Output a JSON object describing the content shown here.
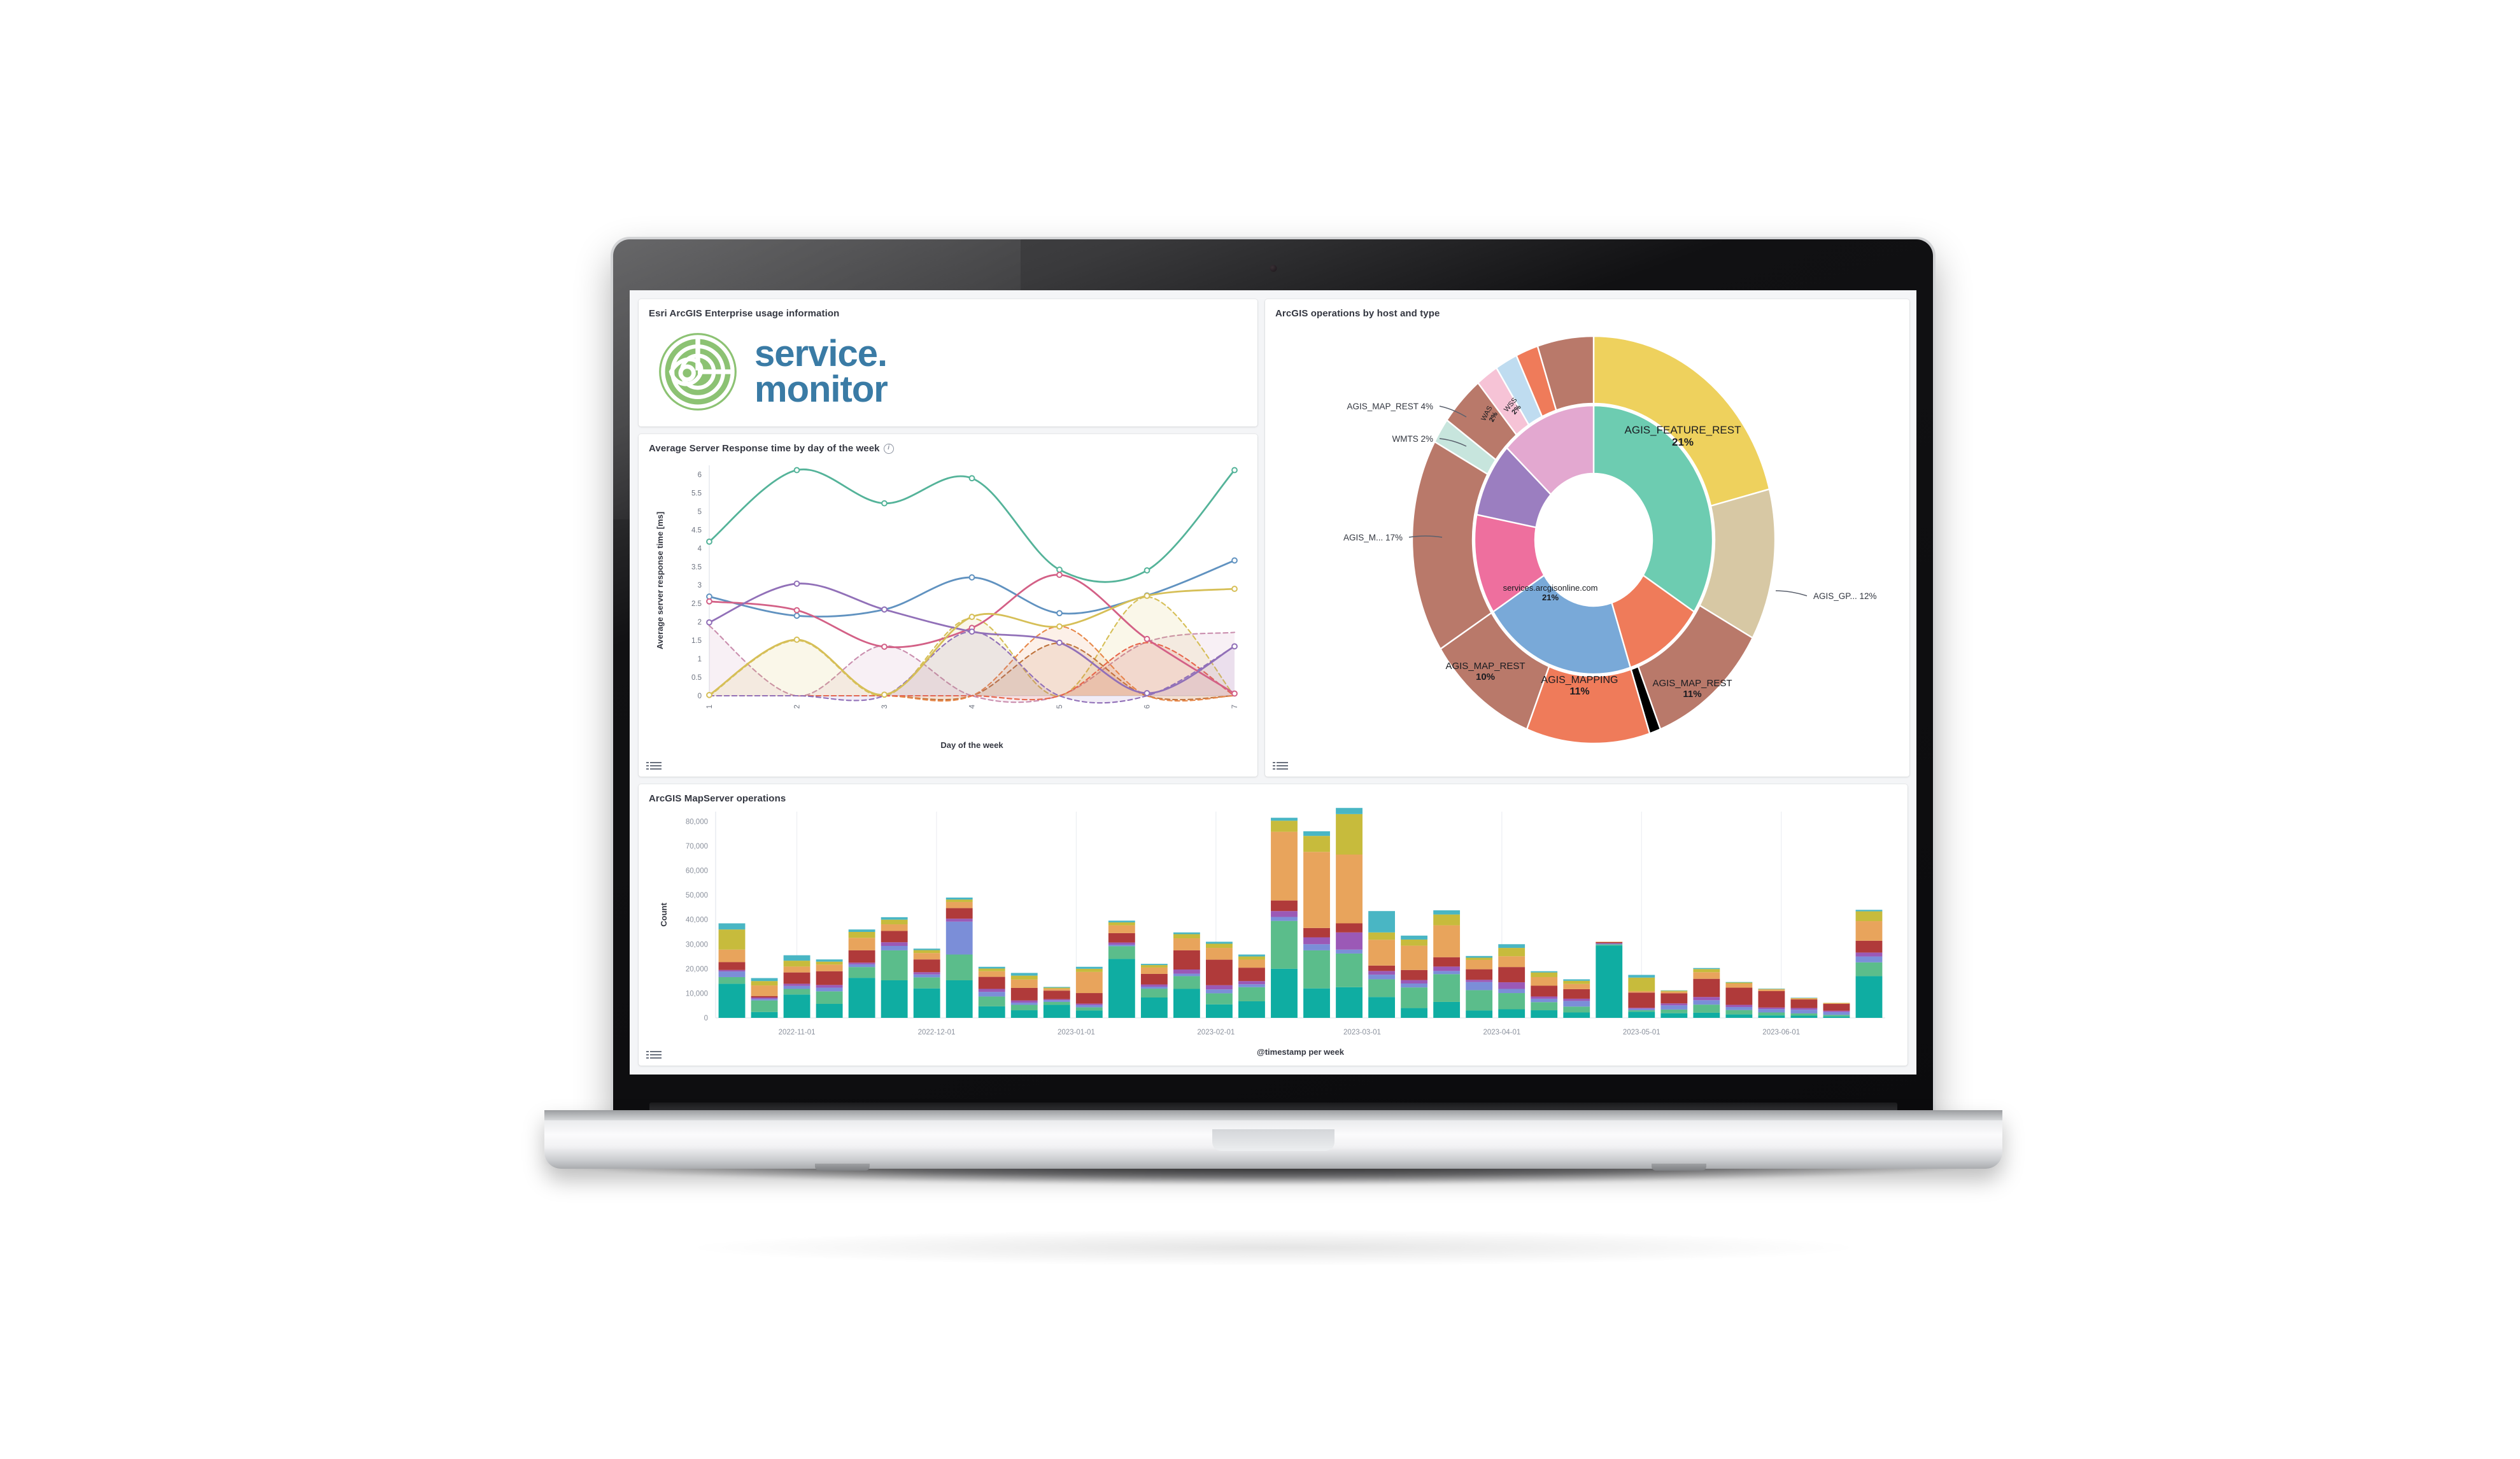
{
  "device": {
    "name": "laptop-mockup"
  },
  "dashboard": {
    "panels": {
      "logo": {
        "title": "Esri ArcGIS Enterprise usage information",
        "logo_word_1": "service",
        "logo_dot": ".",
        "logo_word_2": "monitor",
        "logo_icon": "service-monitor-target-eye-icon",
        "legend_icon": "legend-list-icon"
      },
      "line": {
        "title": "Average Server Response time by day of the week",
        "info_icon": "info-circle-icon",
        "legend_icon": "legend-list-icon"
      },
      "donut": {
        "title": "ArcGIS operations by host and type",
        "legend_icon": "legend-list-icon"
      },
      "bars": {
        "title": "ArcGIS MapServer operations",
        "legend_icon": "legend-list-icon"
      }
    }
  },
  "chart_data": [
    {
      "id": "avg-server-response-time",
      "type": "line",
      "title": "Average Server Response time by day of the week",
      "xlabel": "Day of the week",
      "ylabel": "Average server response time [ms]",
      "x": [
        1,
        2,
        3,
        4,
        5,
        6,
        7
      ],
      "xticklabels": [
        "1",
        "2",
        "3",
        "4",
        "5",
        "6",
        "7"
      ],
      "ylim": [
        0,
        6.25
      ],
      "yticks": [
        0,
        0.5,
        1,
        1.5,
        2,
        2.5,
        3,
        3.5,
        4,
        4.5,
        5,
        5.5,
        6
      ],
      "yticklabels": [
        "0",
        "0.5",
        "1",
        "1.5",
        "2",
        "2.5",
        "3",
        "3.5",
        "4",
        "4.5",
        "5",
        "5.5",
        "6"
      ],
      "grid": false,
      "legend": "hidden",
      "series": [
        {
          "name": "series-green",
          "color": "#54b399",
          "style": "solid",
          "marker": "circle",
          "values": [
            4.18,
            6.12,
            5.22,
            5.9,
            3.42,
            3.4,
            6.12
          ]
        },
        {
          "name": "series-blue",
          "color": "#6092c0",
          "style": "solid",
          "marker": "circle",
          "values": [
            2.69,
            2.17,
            2.34,
            3.21,
            2.24,
            2.72,
            3.67
          ]
        },
        {
          "name": "series-pink",
          "color": "#d36086",
          "style": "solid",
          "marker": "circle",
          "values": [
            2.56,
            2.32,
            1.33,
            1.84,
            3.28,
            1.54,
            0.06
          ]
        },
        {
          "name": "series-purple",
          "color": "#9170b8",
          "style": "solid",
          "marker": "circle",
          "values": [
            1.99,
            3.04,
            2.34,
            1.74,
            1.44,
            0.07,
            1.34
          ]
        },
        {
          "name": "series-yellow",
          "color": "#d6bf57",
          "style": "solid",
          "marker": "circle",
          "values": [
            0.02,
            1.52,
            0.03,
            2.14,
            1.88,
            2.71,
            2.9
          ]
        },
        {
          "name": "series-magenta-dash",
          "color": "#ca8eae",
          "style": "dashed",
          "marker": "none",
          "values": [
            1.9,
            0.0,
            1.36,
            0.0,
            0.0,
            1.46,
            1.72
          ]
        },
        {
          "name": "series-gold-dash",
          "color": "#d6bf57",
          "style": "dashed",
          "marker": "none",
          "values": [
            0.0,
            1.5,
            0.0,
            2.1,
            0.0,
            2.68,
            0.0
          ]
        },
        {
          "name": "series-brown-dash",
          "color": "#b9703a",
          "style": "dashed",
          "marker": "none",
          "values": [
            0.0,
            0.0,
            0.0,
            0.0,
            1.43,
            0.0,
            0.0
          ]
        },
        {
          "name": "series-orange-dash",
          "color": "#e7884a",
          "style": "dashed",
          "marker": "none",
          "values": [
            0.0,
            0.0,
            0.0,
            0.0,
            1.88,
            0.0,
            0.0
          ]
        },
        {
          "name": "series-red-dash",
          "color": "#e7664c",
          "style": "dashed",
          "marker": "none",
          "values": [
            0.0,
            0.0,
            0.0,
            0.0,
            0.0,
            1.44,
            0.0
          ]
        },
        {
          "name": "series-violet-dash",
          "color": "#9170b8",
          "style": "dashed",
          "marker": "none",
          "values": [
            0.0,
            0.0,
            0.0,
            1.74,
            0.0,
            0.0,
            1.34
          ]
        }
      ]
    },
    {
      "id": "arcgis-operations-by-host-and-type",
      "type": "pie",
      "variant": "sunburst-donut",
      "title": "ArcGIS operations by host and type",
      "legend": "hidden",
      "inner_ring": [
        {
          "label": "",
          "percent": 34,
          "color": "#6dccb1",
          "label_shown": false
        },
        {
          "label": "AGIS_MAPPING",
          "percent": 11,
          "color": "#ef7b5a",
          "label_shown": true,
          "label_position": "inside"
        },
        {
          "label": "services.arcgisonline.com",
          "percent": 21,
          "color": "#79a9d8",
          "label_shown": true,
          "label_position": "inside"
        },
        {
          "label": "",
          "percent": 12,
          "color": "#ee6f9e",
          "label_shown": false
        },
        {
          "label": "",
          "percent": 9,
          "color": "#9b7ec0",
          "label_shown": false
        },
        {
          "label": "",
          "percent": 13,
          "color": "#e3a8d0",
          "label_shown": false
        }
      ],
      "outer_ring": [
        {
          "label": "AGIS_FEATURE_REST",
          "percent": 21,
          "color": "#eed15d",
          "label_shown": true,
          "label_position": "inside"
        },
        {
          "label": "AGIS_GP...",
          "percent": 12,
          "color": "#d7c8a4",
          "label_shown": true,
          "label_position": "callout-right"
        },
        {
          "label": "AGIS_MAP_REST",
          "percent": 11,
          "color": "#b9796a",
          "label_shown": true,
          "label_position": "inside"
        },
        {
          "label": "",
          "percent": 1,
          "color": "#f3a martial",
          "label_shown": false
        },
        {
          "label": "AGIS_MAPPING",
          "percent": 11,
          "color": "#ef7b5a",
          "label_shown": true,
          "label_position": "inside"
        },
        {
          "label": "AGIS_MAP_REST",
          "percent": 10,
          "color": "#b9796a",
          "label_shown": true,
          "label_position": "inside"
        },
        {
          "label": "AGIS_M...",
          "percent": 17,
          "color": "#b9796a",
          "label_shown": true,
          "label_position": "callout-left"
        },
        {
          "label": "WMTS",
          "percent": 2,
          "color": "#c7e5dd",
          "label_shown": true,
          "label_position": "callout-left"
        },
        {
          "label": "AGIS_MAP_REST",
          "percent": 4,
          "color": "#b9796a",
          "label_shown": true,
          "label_position": "callout-left"
        },
        {
          "label": "WAS",
          "percent": 2,
          "color": "#f6c3d6",
          "label_shown": true,
          "label_position": "radial"
        },
        {
          "label": "WSS",
          "percent": 2,
          "color": "#bfdcf0",
          "label_shown": true,
          "label_position": "radial"
        },
        {
          "label": "",
          "percent": 2,
          "color": "#ef7b5a",
          "label_shown": false
        },
        {
          "label": "",
          "percent": 5,
          "color": "#b9796a",
          "label_shown": false
        }
      ],
      "callouts": [
        {
          "text": "AGIS_MAP_REST 4%",
          "side": "left"
        },
        {
          "text": "WMTS 2%",
          "side": "left"
        },
        {
          "text": "AGIS_M... 17%",
          "side": "left"
        },
        {
          "text": "AGIS_GP... 12%",
          "side": "right"
        }
      ],
      "inside_labels": [
        {
          "name": "AGIS_FEATURE_REST",
          "value": "21%"
        },
        {
          "name": "AGIS_MAP_REST",
          "value": "11%"
        },
        {
          "name": "AGIS_MAPPING",
          "value": "11%"
        },
        {
          "name": "AGIS_MAP_REST",
          "value": "10%"
        },
        {
          "name": "services.arcgisonline.com",
          "value": "21%"
        },
        {
          "name": "WAS",
          "value": "2%"
        },
        {
          "name": "WSS",
          "value": "2%"
        }
      ]
    },
    {
      "id": "arcgis-mapserver-operations",
      "type": "bar",
      "variant": "stacked",
      "title": "ArcGIS MapServer operations",
      "xlabel": "@timestamp per week",
      "ylabel": "Count",
      "ylim": [
        0,
        84000
      ],
      "yticks": [
        0,
        10000,
        20000,
        30000,
        40000,
        50000,
        60000,
        70000,
        80000
      ],
      "yticklabels": [
        "0",
        "10,000",
        "20,000",
        "30,000",
        "40,000",
        "50,000",
        "60,000",
        "70,000",
        "80,000"
      ],
      "xticklabels": [
        "2022-11-01",
        "2022-12-01",
        "2023-01-01",
        "2023-02-01",
        "2023-03-01",
        "2023-04-01",
        "2023-05-01",
        "2023-06-01"
      ],
      "xtick_positions": [
        2.5,
        6.8,
        11.1,
        15.4,
        19.9,
        24.2,
        28.5,
        32.8
      ],
      "grid": true,
      "legend": "hidden",
      "stack_colors": [
        "#0fada2",
        "#5bbd8b",
        "#7b8ed8",
        "#9b59b6",
        "#b03a3a",
        "#e8a45c",
        "#c7bb3c",
        "#49b6c4",
        "#3db7a0",
        "#cf7fc4"
      ],
      "totals": [
        38500,
        16200,
        25500,
        23800,
        36000,
        41000,
        28200,
        49000,
        20800,
        18300,
        12600,
        20800,
        39600,
        22000,
        34800,
        31000,
        25800,
        81500,
        76000,
        85500,
        43500,
        33500,
        43800,
        25200,
        30000,
        19000,
        15700,
        31000,
        17500,
        11200,
        20300,
        14600,
        11900,
        8200,
        6100,
        44000
      ],
      "stacks": [
        [
          13900,
          2700,
          2300,
          600,
          3200,
          5100,
          8200,
          2500
        ],
        [
          2400,
          4700,
          600,
          600,
          600,
          4300,
          1800,
          1200
        ],
        [
          9500,
          2300,
          1200,
          900,
          4600,
          2400,
          2400,
          2200
        ],
        [
          5700,
          5100,
          1500,
          1100,
          5600,
          2700,
          1200,
          900
        ],
        [
          16300,
          4400,
          1100,
          700,
          5000,
          5100,
          2400,
          1000
        ],
        [
          15300,
          12200,
          1800,
          1500,
          4600,
          2700,
          1900,
          1000
        ],
        [
          12000,
          4500,
          1200,
          900,
          5200,
          2600,
          1200,
          600
        ],
        [
          15300,
          10500,
          13400,
          1200,
          4300,
          2500,
          1000,
          800
        ],
        [
          4700,
          4000,
          1900,
          1200,
          4900,
          2300,
          1100,
          700
        ],
        [
          3100,
          2200,
          900,
          900,
          5100,
          3400,
          1600,
          1100
        ],
        [
          5300,
          1200,
          700,
          400,
          3500,
          800,
          400,
          300
        ],
        [
          3000,
          1300,
          900,
          600,
          4300,
          8600,
          1300,
          800
        ],
        [
          24000,
          5200,
          600,
          900,
          3800,
          3200,
          1200,
          700
        ],
        [
          8300,
          3600,
          800,
          900,
          4300,
          2600,
          1000,
          500
        ],
        [
          11800,
          5200,
          1000,
          1700,
          7800,
          4900,
          1700,
          700
        ],
        [
          5500,
          4500,
          1600,
          1700,
          10400,
          4800,
          1700,
          800
        ],
        [
          6800,
          5800,
          1200,
          1300,
          5500,
          3300,
          1300,
          800
        ],
        [
          20000,
          19500,
          1600,
          2400,
          4300,
          28000,
          4500,
          1200
        ],
        [
          12000,
          15500,
          2500,
          2800,
          3800,
          31000,
          6500,
          1900
        ],
        [
          12500,
          13700,
          1600,
          7000,
          3700,
          28000,
          16500,
          2500
        ],
        [
          8500,
          7200,
          1900,
          1500,
          2200,
          10500,
          3000,
          8700
        ],
        [
          4000,
          8400,
          1600,
          1400,
          4100,
          9900,
          2500,
          1600
        ],
        [
          6500,
          11300,
          1300,
          1800,
          3800,
          13000,
          4400,
          1700
        ],
        [
          3000,
          8300,
          3300,
          900,
          4300,
          3800,
          900,
          700
        ],
        [
          3500,
          6600,
          1700,
          2700,
          6200,
          4400,
          3400,
          1500
        ],
        [
          3100,
          3300,
          1400,
          900,
          4400,
          3500,
          1900,
          500
        ],
        [
          2200,
          2400,
          2300,
          900,
          3900,
          2100,
          1300,
          600
        ],
        [
          29500,
          400,
          300,
          200,
          500,
          100,
          0,
          0
        ],
        [
          2500,
          600,
          600,
          400,
          6200,
          600,
          5500,
          1100
        ],
        [
          1900,
          1500,
          1700,
          800,
          4100,
          700,
          400,
          100
        ],
        [
          2100,
          3300,
          1800,
          1300,
          7400,
          2700,
          1300,
          400
        ],
        [
          1400,
          1800,
          1200,
          900,
          7000,
          1700,
          400,
          200
        ],
        [
          1000,
          1200,
          1400,
          600,
          6700,
          700,
          200,
          100
        ],
        [
          900,
          900,
          1500,
          700,
          3500,
          500,
          100,
          100
        ],
        [
          600,
          600,
          1200,
          500,
          2800,
          300,
          100,
          0
        ],
        [
          17000,
          5600,
          2400,
          1600,
          4800,
          8000,
          4000,
          600
        ]
      ]
    }
  ]
}
